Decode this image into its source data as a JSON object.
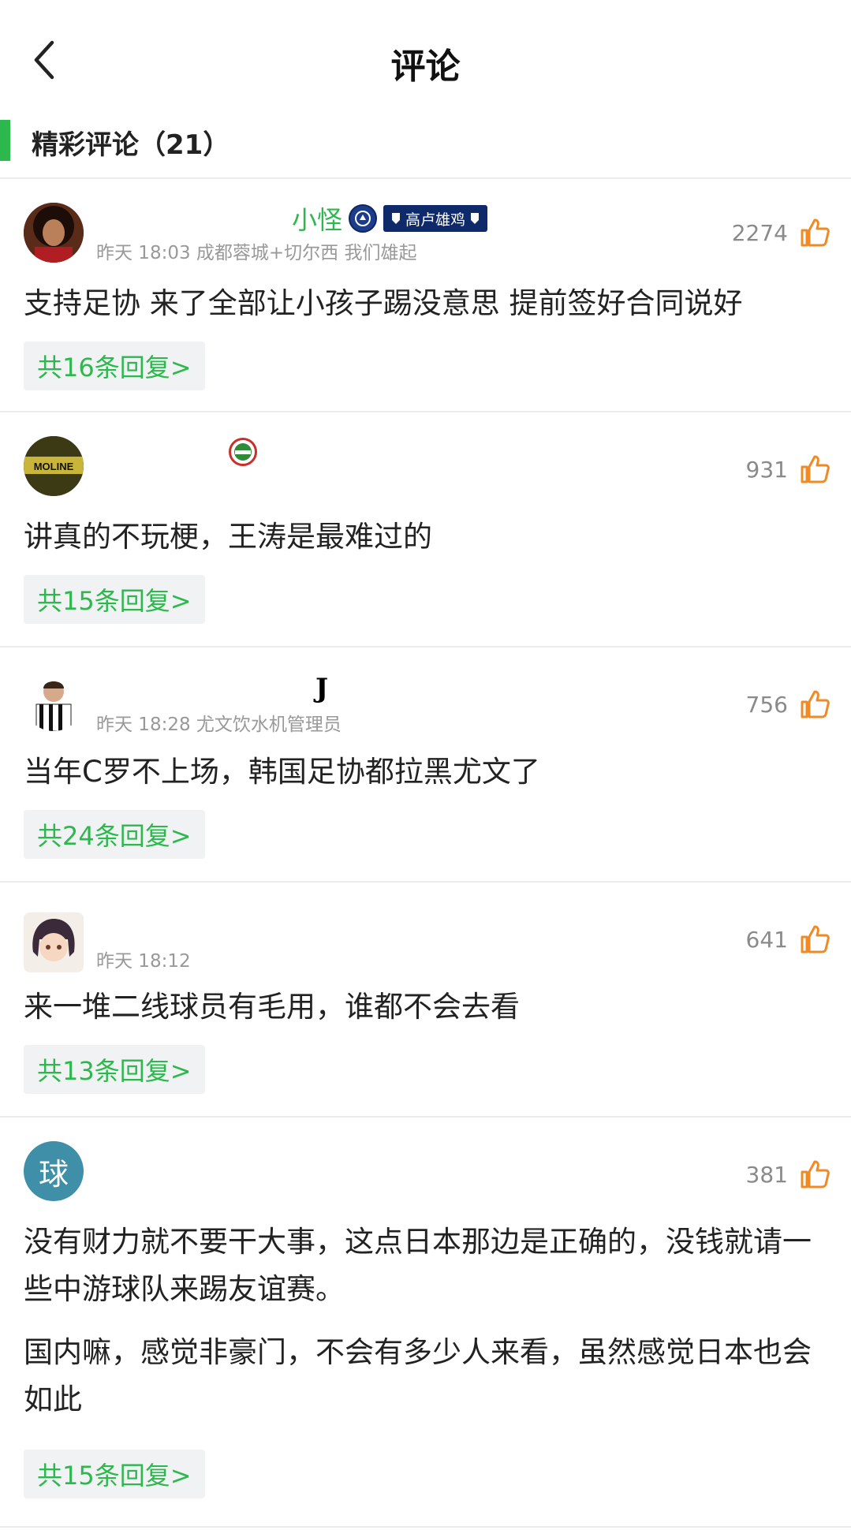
{
  "header": {
    "title": "评论",
    "back_icon": "chevron-left-icon"
  },
  "section": {
    "title": "精彩评论（21）",
    "accent_color": "#2db84d"
  },
  "colors": {
    "green": "#2db84d",
    "like_orange": "#f08a24",
    "meta_gray": "#999999"
  },
  "comments": [
    {
      "username": "小怪",
      "time": "昨天 18:03",
      "tag": "成都蓉城+切尔西 我们雄起",
      "likes": "2274",
      "text": "支持足协 来了全部让小孩子踢没意思 提前签好合同说好",
      "replies": "共16条回复>",
      "badges": [
        "chelsea-badge",
        "scarf-badge"
      ],
      "scarf_text": "高卢雄鸡"
    },
    {
      "username": "",
      "time": "",
      "tag": "",
      "likes": "931",
      "text": "讲真的不玩梗，王涛是最难过的",
      "replies": "共15条回复>",
      "badges": [
        "henan-badge"
      ],
      "avatar_text": "MOLINE"
    },
    {
      "username": "",
      "time": "昨天 18:28",
      "tag": "尤文饮水机管理员",
      "likes": "756",
      "text": "当年C罗不上场，韩国足协都拉黑尤文了",
      "replies": "共24条回复>",
      "badges": [
        "juventus-badge"
      ]
    },
    {
      "username": "",
      "time": "昨天 18:12",
      "tag": "",
      "likes": "641",
      "text": "来一堆二线球员有毛用，谁都不会去看",
      "replies": "共13条回复>",
      "badges": []
    },
    {
      "username": "",
      "time": "",
      "tag": "",
      "likes": "381",
      "text": "没有财力就不要干大事，这点日本那边是正确的，没钱就请一些中游球队来踢友谊赛。",
      "text2": "国内嘛，感觉非豪门，不会有多少人来看，虽然感觉日本也会如此",
      "replies": "共15条回复>",
      "badges": [],
      "avatar_text": "球"
    }
  ]
}
